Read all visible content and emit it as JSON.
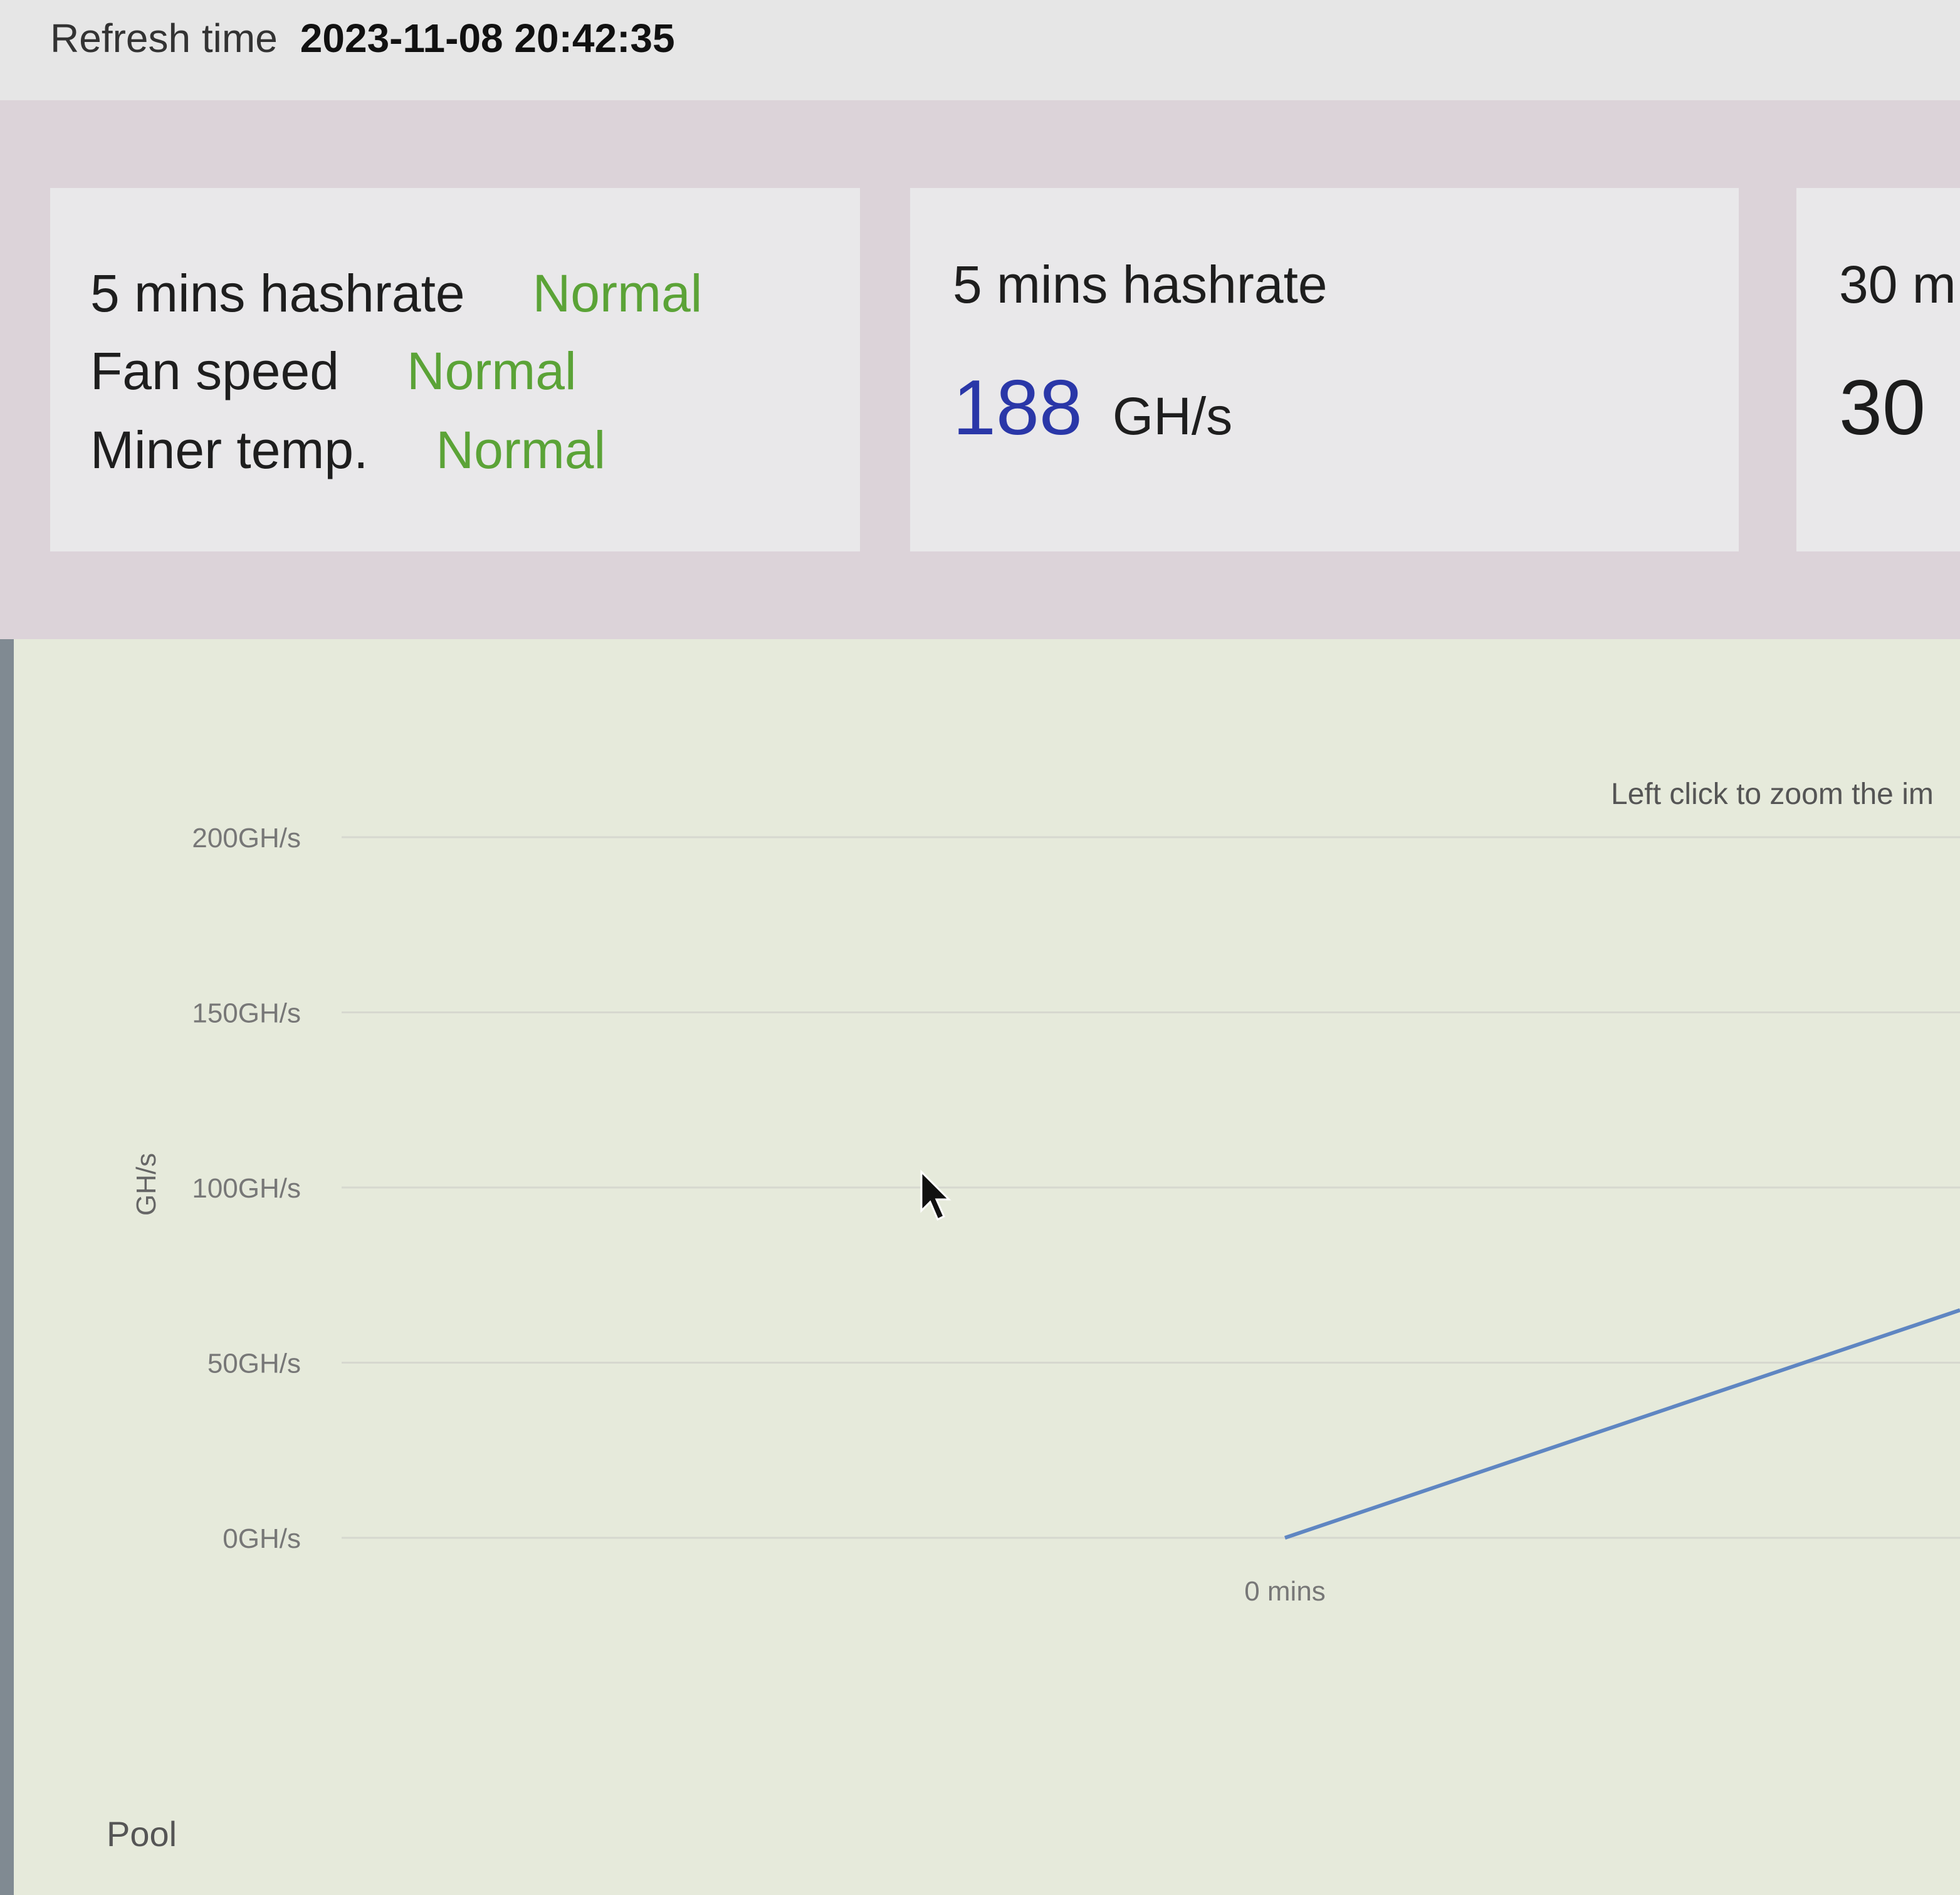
{
  "header": {
    "refresh_label": "Refresh time",
    "refresh_value": "2023-11-08 20:42:35"
  },
  "status_card": {
    "rows": [
      {
        "label": "5 mins hashrate",
        "value": "Normal"
      },
      {
        "label": "Fan speed",
        "value": "Normal"
      },
      {
        "label": "Miner temp.",
        "value": "Normal"
      }
    ]
  },
  "hashrate_5min": {
    "title": "5 mins hashrate",
    "value": "188",
    "unit": "GH/s"
  },
  "hashrate_30min": {
    "title": "30 m",
    "value": "30"
  },
  "chart": {
    "hint": "Left click to zoom the im",
    "footer_label": "Pool"
  },
  "colors": {
    "status_normal": "#5ba337",
    "hashrate_value": "#2a37a8",
    "series_line": "#5f86c2",
    "band_background": "#dcd3d9",
    "chart_background": "#e6eadb"
  },
  "chart_data": {
    "type": "line",
    "ylabel": "GH/s",
    "ylim": [
      0,
      200
    ],
    "y_ticks": [
      200,
      150,
      100,
      50,
      0
    ],
    "y_tick_labels": [
      "200GH/s",
      "150GH/s",
      "100GH/s",
      "50GH/s",
      "0GH/s"
    ],
    "x_tick_labels": [
      "0 mins"
    ],
    "series": [
      {
        "x": [
          0,
          1
        ],
        "values": [
          0,
          65
        ]
      }
    ],
    "grid": true
  }
}
